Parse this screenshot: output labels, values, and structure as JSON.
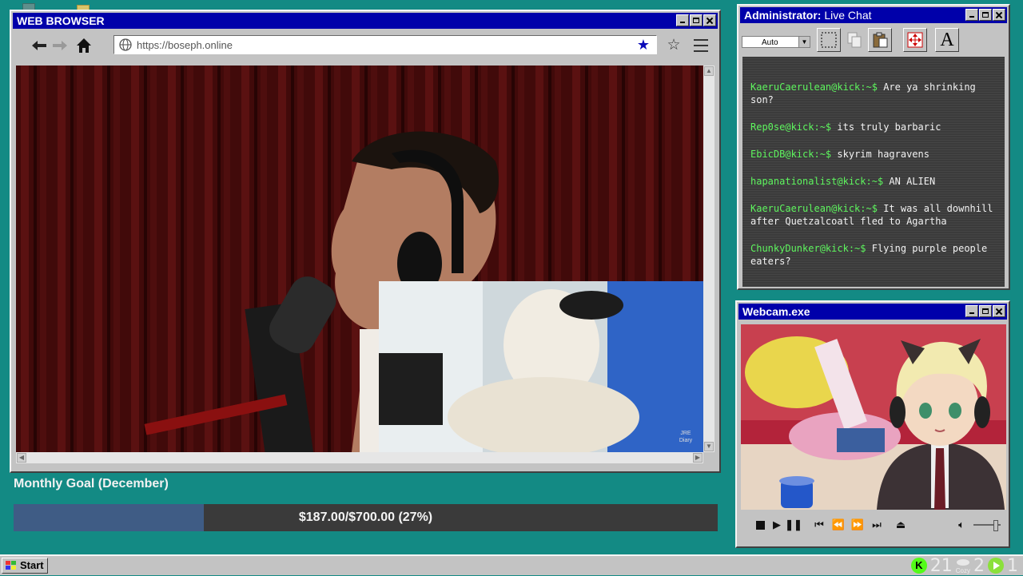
{
  "browser": {
    "title": "WEB BROWSER",
    "url": "https://boseph.online",
    "video_watermark": "JRE\nDiary"
  },
  "goal": {
    "label": "Monthly Goal (December)",
    "progress": 0.27,
    "text": "$187.00/$700.00 (27%)"
  },
  "chat": {
    "title_bold": "Administrator:",
    "title_rest": "Live Chat",
    "font_size_combo": "Auto",
    "messages": [
      {
        "user": "KaeruCaerulean@kick:~$",
        "text": "Are ya shrinking son?"
      },
      {
        "user": "Rep0se@kick:~$",
        "text": "its truly barbaric"
      },
      {
        "user": "EbicDB@kick:~$",
        "text": "skyrim hagravens"
      },
      {
        "user": "hapanationalist@kick:~$",
        "text": "AN ALIEN"
      },
      {
        "user": "KaeruCaerulean@kick:~$",
        "text": "It was all downhill after Quetzalcoatl fled to Agartha"
      },
      {
        "user": "ChunkyDunker@kick:~$",
        "text": "Flying purple people eaters?"
      }
    ]
  },
  "webcam": {
    "title": "Webcam.exe"
  },
  "taskbar": {
    "start_label": "Start",
    "tray_count_1": "21",
    "tray_cozy": "Cozy",
    "tray_count_2": "2",
    "tray_count_3": "1"
  },
  "colors": {
    "desktop": "#138a84",
    "title_bar": "#0000aa",
    "chat_user": "#5ef55e",
    "goal_fill": "#3f5c85"
  }
}
